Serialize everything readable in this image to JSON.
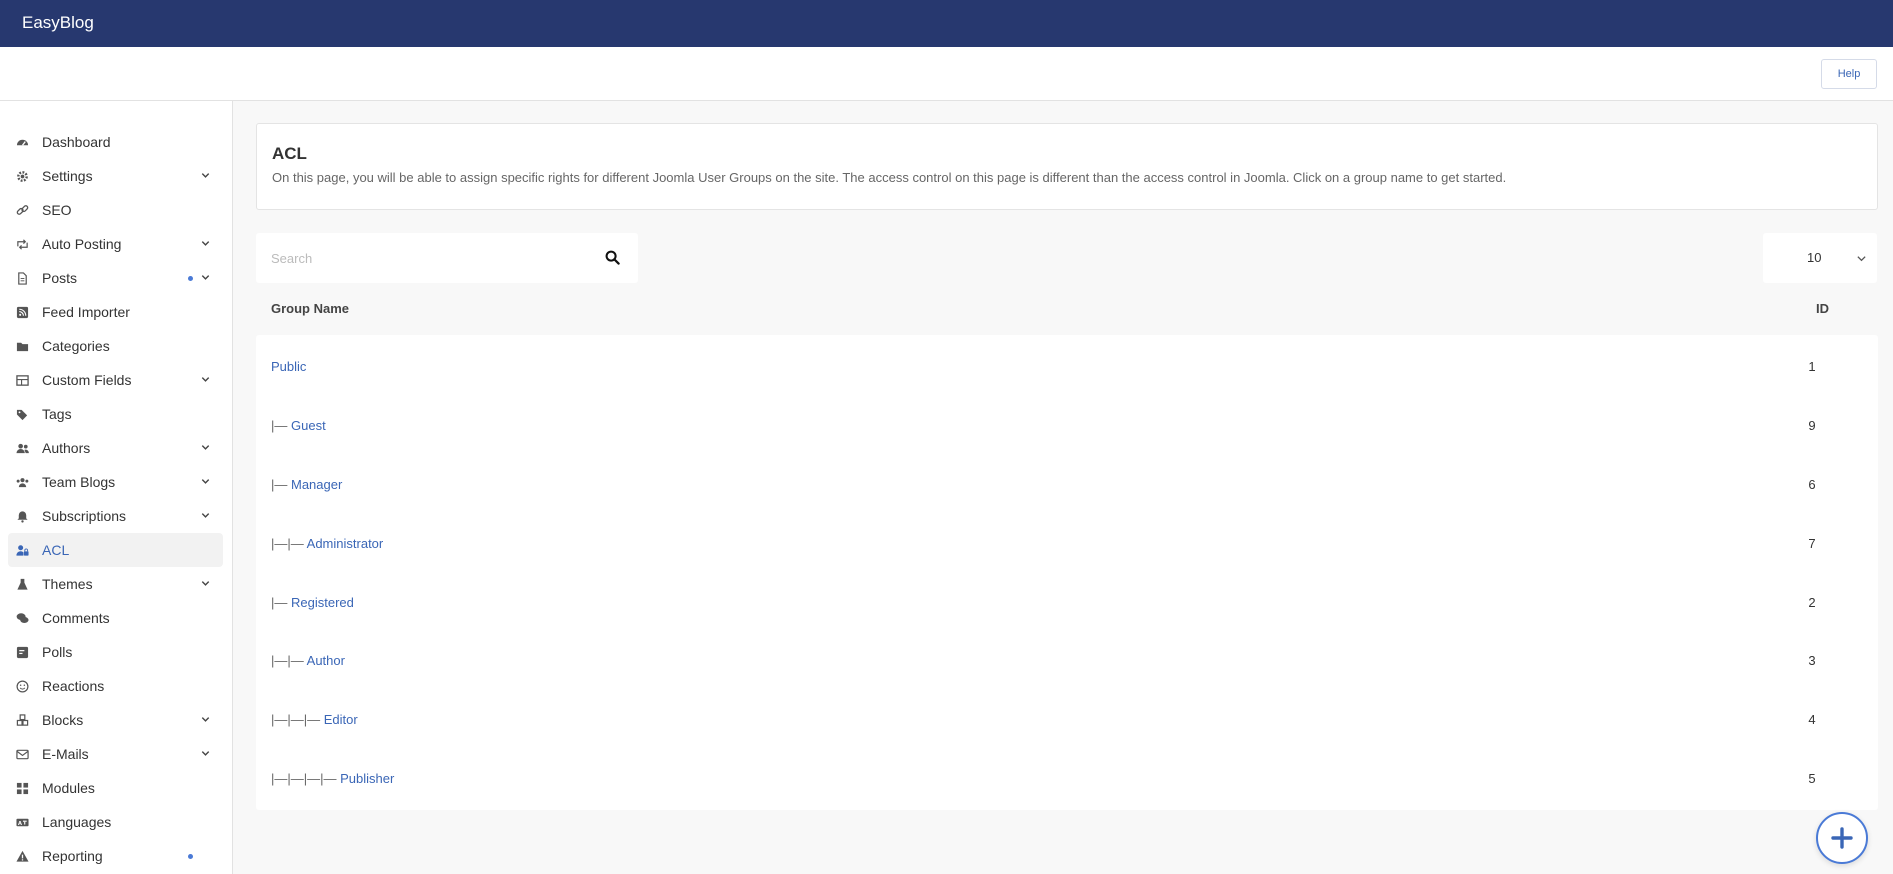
{
  "topbar": {
    "brand": "EasyBlog"
  },
  "toolbar": {
    "help_label": "Help"
  },
  "sidebar": {
    "items": [
      {
        "label": "Dashboard",
        "icon": "dashboard-icon",
        "chevron": false,
        "dot": false,
        "active": false
      },
      {
        "label": "Settings",
        "icon": "gear-icon",
        "chevron": true,
        "dot": false,
        "active": false
      },
      {
        "label": "SEO",
        "icon": "link-icon",
        "chevron": false,
        "dot": false,
        "active": false
      },
      {
        "label": "Auto Posting",
        "icon": "retweet-icon",
        "chevron": true,
        "dot": false,
        "active": false
      },
      {
        "label": "Posts",
        "icon": "file-icon",
        "chevron": true,
        "dot": true,
        "active": false
      },
      {
        "label": "Feed Importer",
        "icon": "rss-icon",
        "chevron": false,
        "dot": false,
        "active": false
      },
      {
        "label": "Categories",
        "icon": "folder-icon",
        "chevron": false,
        "dot": false,
        "active": false
      },
      {
        "label": "Custom Fields",
        "icon": "table-icon",
        "chevron": true,
        "dot": false,
        "active": false
      },
      {
        "label": "Tags",
        "icon": "tags-icon",
        "chevron": false,
        "dot": false,
        "active": false
      },
      {
        "label": "Authors",
        "icon": "users-icon",
        "chevron": true,
        "dot": false,
        "active": false
      },
      {
        "label": "Team Blogs",
        "icon": "team-icon",
        "chevron": true,
        "dot": false,
        "active": false
      },
      {
        "label": "Subscriptions",
        "icon": "bell-icon",
        "chevron": true,
        "dot": false,
        "active": false
      },
      {
        "label": "ACL",
        "icon": "user-lock-icon",
        "chevron": false,
        "dot": false,
        "active": true
      },
      {
        "label": "Themes",
        "icon": "flask-icon",
        "chevron": true,
        "dot": false,
        "active": false
      },
      {
        "label": "Comments",
        "icon": "comments-icon",
        "chevron": false,
        "dot": false,
        "active": false
      },
      {
        "label": "Polls",
        "icon": "poll-icon",
        "chevron": false,
        "dot": false,
        "active": false
      },
      {
        "label": "Reactions",
        "icon": "smile-icon",
        "chevron": false,
        "dot": false,
        "active": false
      },
      {
        "label": "Blocks",
        "icon": "cubes-icon",
        "chevron": true,
        "dot": false,
        "active": false
      },
      {
        "label": "E-Mails",
        "icon": "envelope-icon",
        "chevron": true,
        "dot": false,
        "active": false
      },
      {
        "label": "Modules",
        "icon": "grid-icon",
        "chevron": false,
        "dot": false,
        "active": false
      },
      {
        "label": "Languages",
        "icon": "language-icon",
        "chevron": false,
        "dot": false,
        "active": false
      },
      {
        "label": "Reporting",
        "icon": "warning-icon",
        "chevron": false,
        "dot": true,
        "active": false
      }
    ]
  },
  "page": {
    "title": "ACL",
    "description": "On this page, you will be able to assign specific rights for different Joomla User Groups on the site. The access control on this page is different than the access control in Joomla. Click on a group name to get started."
  },
  "search": {
    "placeholder": "Search",
    "value": ""
  },
  "limit": {
    "value": "10"
  },
  "table": {
    "columns": {
      "name": "Group Name",
      "id": "ID"
    },
    "rows": [
      {
        "prefix": "",
        "name": "Public",
        "id": "1"
      },
      {
        "prefix": "|— ",
        "name": "Guest",
        "id": "9"
      },
      {
        "prefix": "|— ",
        "name": "Manager",
        "id": "6"
      },
      {
        "prefix": "|—|— ",
        "name": "Administrator",
        "id": "7"
      },
      {
        "prefix": "|— ",
        "name": "Registered",
        "id": "2"
      },
      {
        "prefix": "|—|— ",
        "name": "Author",
        "id": "3"
      },
      {
        "prefix": "|—|—|— ",
        "name": "Editor",
        "id": "4"
      },
      {
        "prefix": "|—|—|—|— ",
        "name": "Publisher",
        "id": "5"
      }
    ]
  },
  "colors": {
    "topbar": "#27386f",
    "accent": "#3a66b6",
    "dot": "#4a7ad6"
  }
}
